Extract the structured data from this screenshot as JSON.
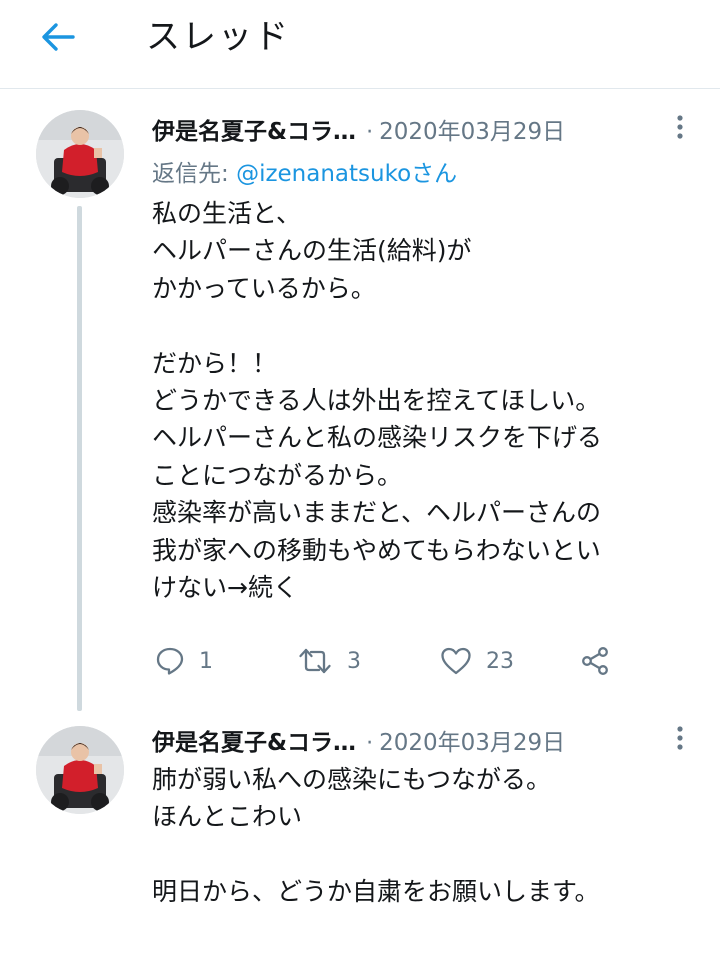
{
  "header": {
    "title": "スレッド",
    "back_icon": "arrow-left-icon"
  },
  "colors": {
    "accent": "#1b95e0",
    "secondary_text": "#657786",
    "primary_text": "#14171a",
    "thread_line": "#cfd9de",
    "divider": "#e1e8ed"
  },
  "tweets": [
    {
      "author": "伊是名夏子&コラ…",
      "separator": "·",
      "date": "2020年03月29日",
      "reply_to_label": "返信先:",
      "reply_to_handle": "@izenanatsukoさん",
      "text": "私の生活と、\nヘルパーさんの生活(給料)が\nかかっているから。\n\nだから！！\nどうかできる人は外出を控えてほしい。\nヘルパーさんと私の感染リスクを下げる\nことにつながるから。\n感染率が高いままだと、ヘルパーさんの\n我が家への移動もやめてもらわないとい\nけない→続く",
      "actions": {
        "replies": "1",
        "retweets": "3",
        "likes": "23"
      }
    },
    {
      "author": "伊是名夏子&コラ…",
      "separator": "·",
      "date": "2020年03月29日",
      "text": "肺が弱い私への感染にもつながる。\nほんとこわい\n\n明日から、どうか自粛をお願いします。"
    }
  ]
}
